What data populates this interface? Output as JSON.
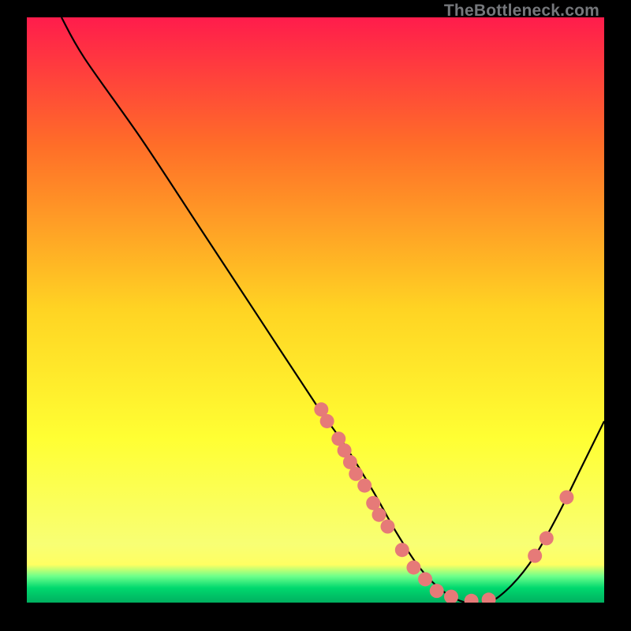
{
  "watermark": "TheBottleneck.com",
  "chart_data": {
    "type": "line",
    "title": "",
    "xlabel": "",
    "ylabel": "",
    "xlim": [
      0,
      100
    ],
    "ylim": [
      0,
      100
    ],
    "gradient_colors": {
      "top": "#ff1c4c",
      "mid1": "#ff6e28",
      "mid2": "#ffd423",
      "mid3": "#ffff33",
      "low": "#f8ff74",
      "band_yellow": "#ffff62",
      "band_green1": "#6dff8b",
      "band_green2": "#00d86e",
      "band_green3": "#00b060"
    },
    "curve": [
      {
        "x": 6,
        "y": 100
      },
      {
        "x": 10,
        "y": 93
      },
      {
        "x": 20,
        "y": 79
      },
      {
        "x": 30,
        "y": 64
      },
      {
        "x": 40,
        "y": 49
      },
      {
        "x": 50,
        "y": 34
      },
      {
        "x": 55,
        "y": 27
      },
      {
        "x": 60,
        "y": 19
      },
      {
        "x": 64,
        "y": 12
      },
      {
        "x": 68,
        "y": 6
      },
      {
        "x": 72,
        "y": 2
      },
      {
        "x": 76,
        "y": 0
      },
      {
        "x": 80,
        "y": 0
      },
      {
        "x": 84,
        "y": 3
      },
      {
        "x": 88,
        "y": 8
      },
      {
        "x": 92,
        "y": 15
      },
      {
        "x": 96,
        "y": 23
      },
      {
        "x": 100,
        "y": 31
      }
    ],
    "markers": [
      {
        "x": 51,
        "y": 33
      },
      {
        "x": 52,
        "y": 31
      },
      {
        "x": 54,
        "y": 28
      },
      {
        "x": 55,
        "y": 26
      },
      {
        "x": 56,
        "y": 24
      },
      {
        "x": 57,
        "y": 22
      },
      {
        "x": 58.5,
        "y": 20
      },
      {
        "x": 60,
        "y": 17
      },
      {
        "x": 61,
        "y": 15
      },
      {
        "x": 62.5,
        "y": 13
      },
      {
        "x": 65,
        "y": 9
      },
      {
        "x": 67,
        "y": 6
      },
      {
        "x": 69,
        "y": 4
      },
      {
        "x": 71,
        "y": 2
      },
      {
        "x": 73.5,
        "y": 1
      },
      {
        "x": 77,
        "y": 0.3
      },
      {
        "x": 80,
        "y": 0.5
      },
      {
        "x": 88,
        "y": 8
      },
      {
        "x": 90,
        "y": 11
      },
      {
        "x": 93.5,
        "y": 18
      }
    ],
    "marker_color": "#e67a78",
    "marker_radius": 9
  }
}
